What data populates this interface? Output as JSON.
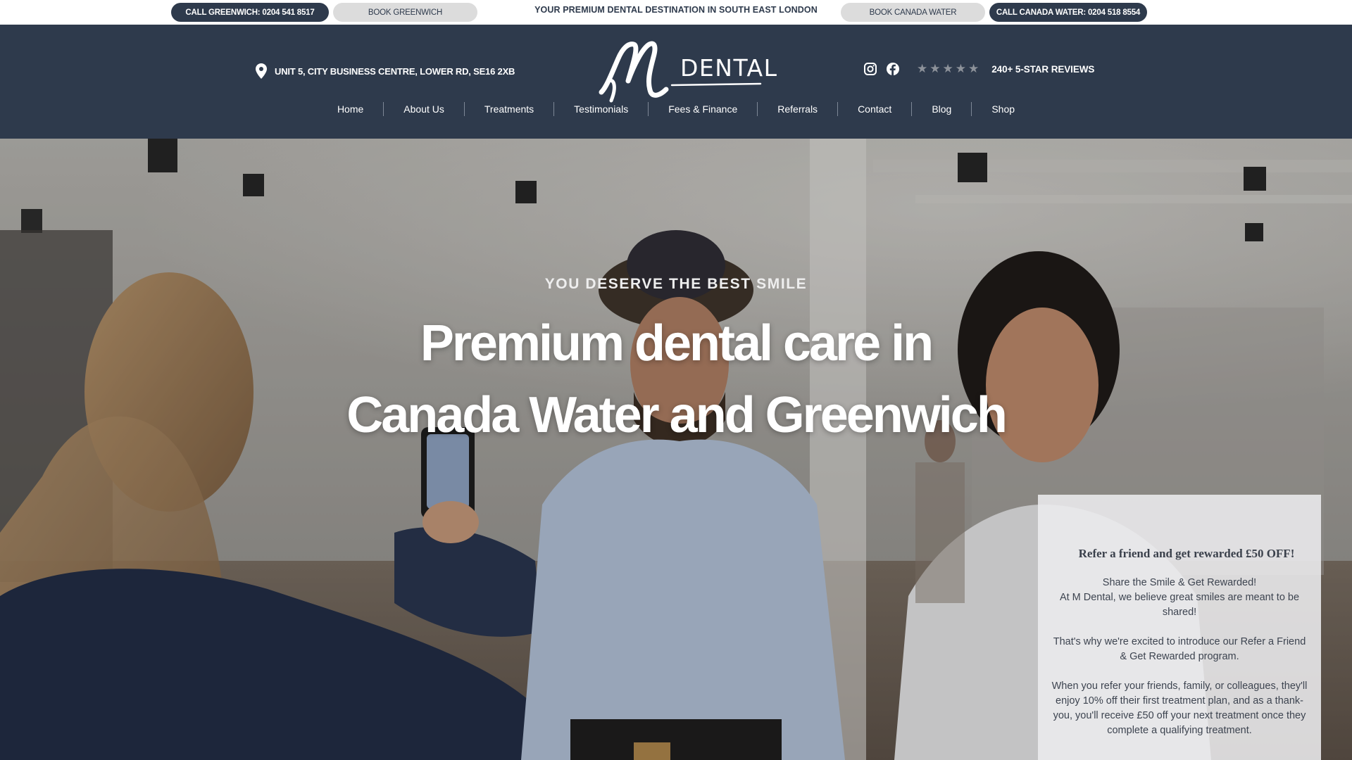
{
  "topbar": {
    "call_greenwich": "CALL GREENWICH: 0204 541 8517",
    "book_greenwich": "BOOK GREENWICH",
    "tagline": "YOUR PREMIUM DENTAL DESTINATION IN SOUTH EAST LONDON",
    "book_canada_water": "BOOK CANADA WATER",
    "call_canada_water": "CALL CANADA WATER: 0204 518 8554"
  },
  "header": {
    "address": "UNIT 5, CITY BUSINESS CENTRE, LOWER RD, SE16 2XB",
    "logo_text": "DENTAL",
    "reviews": "240+ 5-STAR REVIEWS",
    "star_count": 5
  },
  "nav": {
    "items": [
      {
        "label": "Home"
      },
      {
        "label": "About Us"
      },
      {
        "label": "Treatments"
      },
      {
        "label": "Testimonials"
      },
      {
        "label": "Fees & Finance"
      },
      {
        "label": "Referrals"
      },
      {
        "label": "Contact"
      },
      {
        "label": "Blog"
      },
      {
        "label": "Shop"
      }
    ]
  },
  "hero": {
    "eyebrow": "YOU DESERVE THE BEST SMILE",
    "headline_line1": "Premium dental care in",
    "headline_line2": "Canada Water and Greenwich"
  },
  "referral_panel": {
    "title": "Refer a friend and get rewarded £50 OFF!",
    "paragraph1_line1": "Share the Smile & Get Rewarded!",
    "paragraph1_line2": "At M Dental, we believe great smiles are meant to be shared!",
    "paragraph2": "That's why we're excited to introduce our Refer a Friend & Get Rewarded program.",
    "paragraph3": "When you refer your friends, family, or colleagues, they'll enjoy 10% off their first treatment plan, and as a thank-you, you'll receive £50 off your next treatment once they complete a qualifying treatment."
  },
  "colors": {
    "navy": "#2e3a4c",
    "pill_light": "#dcdcdc",
    "star_grey": "#8d929a"
  },
  "icons": [
    "map-pin-icon",
    "instagram-icon",
    "facebook-icon",
    "star-icon"
  ]
}
